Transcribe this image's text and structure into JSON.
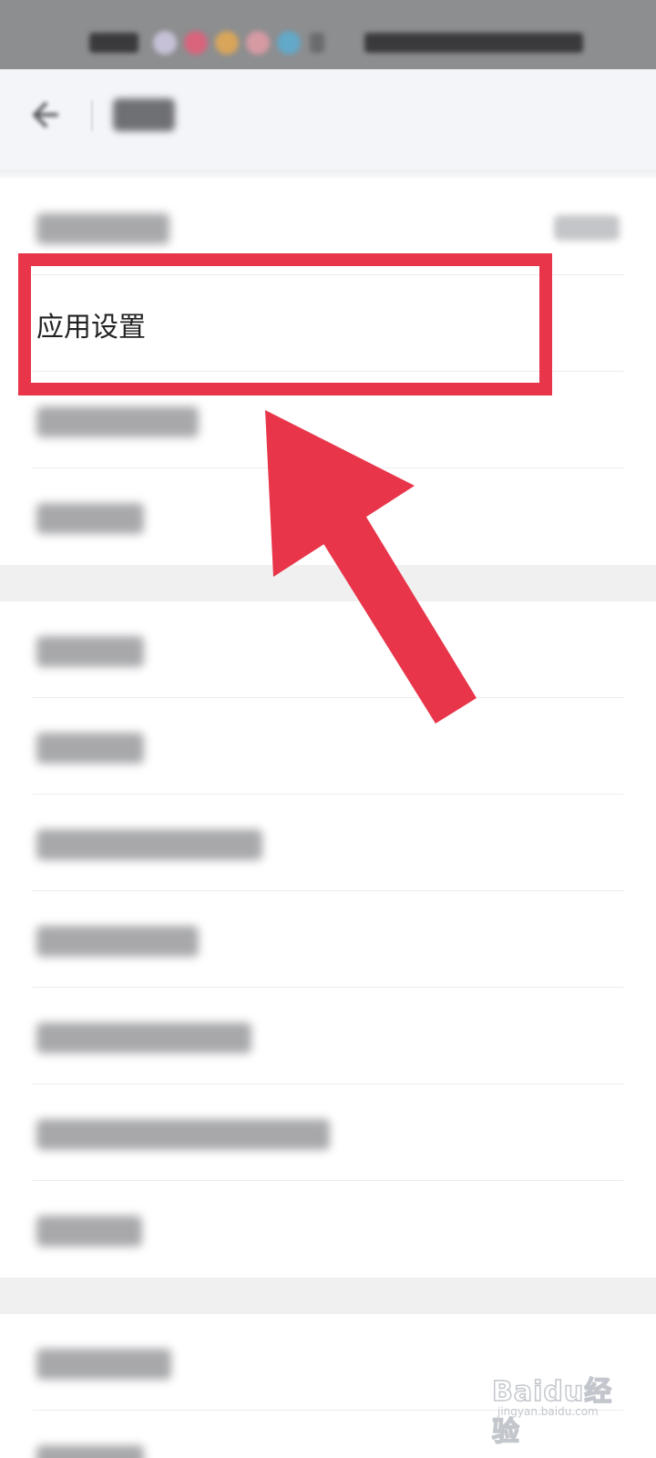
{
  "list": {
    "app_settings_label": "应用设置"
  },
  "watermark": {
    "brand": "Baidu经验",
    "url": "jingyan.baidu.com"
  },
  "colors": {
    "annotation_red": "#e8354a",
    "statusbar_gray": "#8d8e90",
    "appbar_bg": "#f4f5f9",
    "section_gap": "#f0f0f0"
  },
  "icons": {
    "back": "back-arrow-icon"
  }
}
